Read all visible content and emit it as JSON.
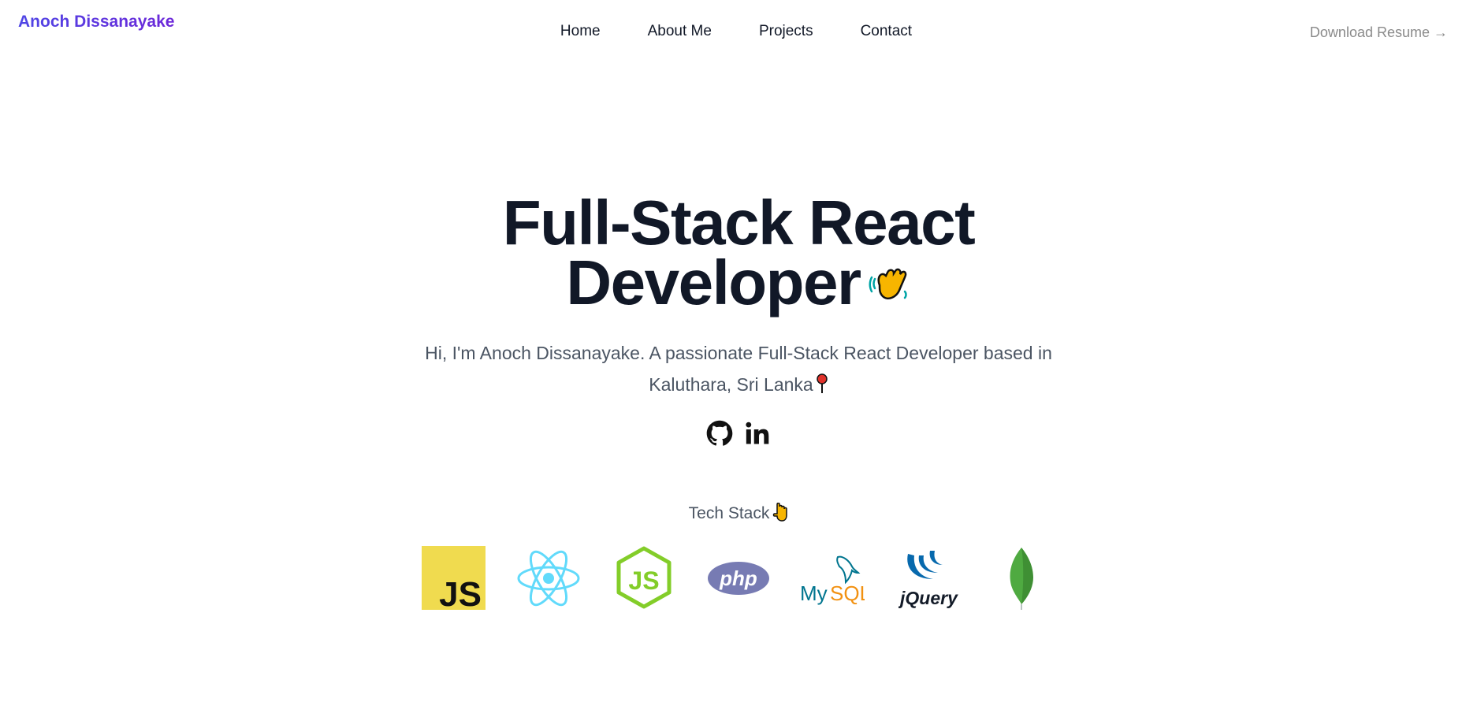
{
  "header": {
    "brand": "Anoch Dissanayake",
    "nav": [
      "Home",
      "About Me",
      "Projects",
      "Contact"
    ],
    "resume_label": "Download Resume →"
  },
  "hero": {
    "title_line1": "Full-Stack React",
    "title_line2": "Developer",
    "intro_line1": "Hi, I'm Anoch Dissanayake. A passionate Full-Stack React Developer based in",
    "intro_line2": "Kaluthara, Sri Lanka"
  },
  "social": [
    "github-icon",
    "linkedin-icon"
  ],
  "tech_stack": {
    "label": "Tech Stack",
    "logos": [
      "JS",
      "React",
      "Node.js",
      "php",
      "MySQL",
      "jQuery",
      "MongoDB"
    ]
  },
  "colors": {
    "brand_gradient": [
      "#4f46e5",
      "#6d28d9"
    ],
    "title": "#111827",
    "body_text": "#4b5563",
    "muted": "#8b8b8b"
  }
}
